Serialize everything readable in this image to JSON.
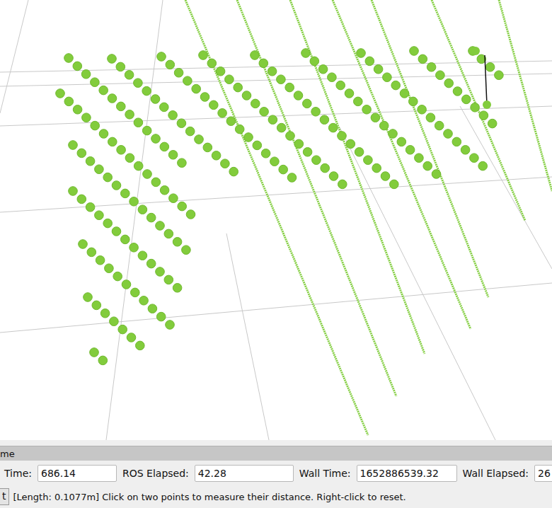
{
  "viewport": {
    "measure_line": true
  },
  "panel": {
    "title": "me"
  },
  "fields": [
    {
      "label": "Time:",
      "value": "686.14"
    },
    {
      "label": "ROS Elapsed:",
      "value": "42.28"
    },
    {
      "label": "Wall Time:",
      "value": "1652886539.32"
    },
    {
      "label": "Wall Elapsed:",
      "value": "26"
    }
  ],
  "status_bar": {
    "button": "t",
    "message": "[Length: 0.1077m] Click on two points to measure their distance. Right-click to reset."
  }
}
